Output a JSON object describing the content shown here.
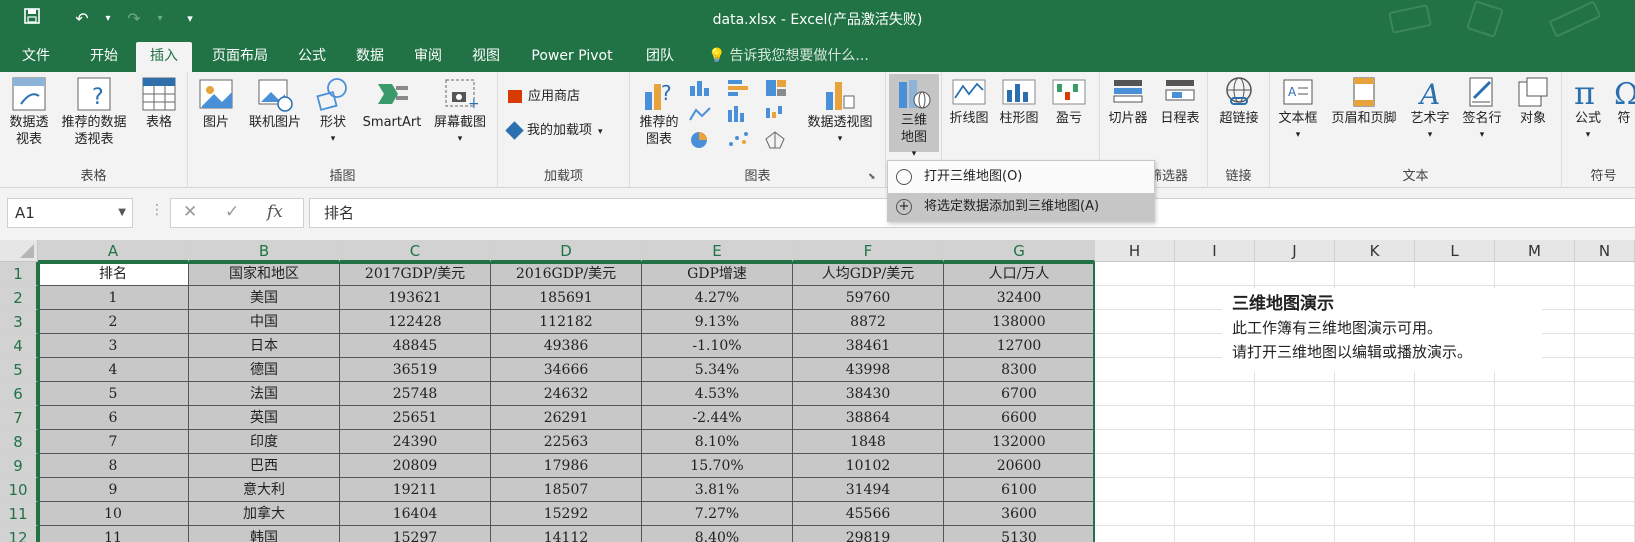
{
  "window": {
    "title": "data.xlsx - Excel(产品激活失败)"
  },
  "quick_access": {
    "save": "save-icon",
    "undo": "undo-icon",
    "redo": "redo-icon",
    "customize": "▾"
  },
  "tabs": [
    "文件",
    "开始",
    "插入",
    "页面布局",
    "公式",
    "数据",
    "审阅",
    "视图",
    "Power Pivot",
    "团队"
  ],
  "active_tab": "插入",
  "tell_me": "告诉我您想要做什么...",
  "ribbon": {
    "groups": {
      "tables": {
        "label": "表格",
        "buttons": [
          "数据透视表",
          "推荐的数据透视表",
          "表格"
        ]
      },
      "illustrations": {
        "label": "插图",
        "buttons": [
          "图片",
          "联机图片",
          "形状",
          "SmartArt",
          "屏幕截图"
        ]
      },
      "addins": {
        "label": "加载项",
        "store": "应用商店",
        "my_addins": "我的加载项"
      },
      "charts": {
        "label": "图表",
        "recommended": "推荐的图表",
        "pivot_chart": "数据透视图"
      },
      "tours": {
        "label": "三维地图"
      },
      "sparklines": {
        "buttons": [
          "折线图",
          "柱形图",
          "盈亏"
        ]
      },
      "filters": {
        "label": "筛选器",
        "buttons": [
          "切片器",
          "日程表"
        ]
      },
      "links": {
        "label": "链接",
        "buttons": [
          "超链接"
        ]
      },
      "text": {
        "label": "文本",
        "buttons": [
          "文本框",
          "页眉和页脚",
          "艺术字",
          "签名行",
          "对象"
        ]
      },
      "symbols": {
        "label": "符号",
        "buttons": [
          "公式",
          "符"
        ]
      }
    }
  },
  "map_dropdown": {
    "items": [
      "打开三维地图(O)",
      "将选定数据添加到三维地图(A)"
    ]
  },
  "formula_bar": {
    "name_box": "A1",
    "content": "排名"
  },
  "columns": [
    "A",
    "B",
    "C",
    "D",
    "E",
    "F",
    "G",
    "H",
    "I",
    "J",
    "K",
    "L",
    "M",
    "N"
  ],
  "rows": [
    "1",
    "2",
    "3",
    "4",
    "5",
    "6",
    "7",
    "8",
    "9",
    "10",
    "11",
    "12"
  ],
  "table": {
    "headers": [
      "排名",
      "国家和地区",
      "2017GDP/美元",
      "2016GDP/美元",
      "GDP增速",
      "人均GDP/美元",
      "人口/万人"
    ],
    "rows": [
      [
        "1",
        "美国",
        "193621",
        "185691",
        "4.27%",
        "59760",
        "32400"
      ],
      [
        "2",
        "中国",
        "122428",
        "112182",
        "9.13%",
        "8872",
        "138000"
      ],
      [
        "3",
        "日本",
        "48845",
        "49386",
        "-1.10%",
        "38461",
        "12700"
      ],
      [
        "4",
        "德国",
        "36519",
        "34666",
        "5.34%",
        "43998",
        "8300"
      ],
      [
        "5",
        "法国",
        "25748",
        "24632",
        "4.53%",
        "38430",
        "6700"
      ],
      [
        "6",
        "英国",
        "25651",
        "26291",
        "-2.44%",
        "38864",
        "6600"
      ],
      [
        "7",
        "印度",
        "24390",
        "22563",
        "8.10%",
        "1848",
        "132000"
      ],
      [
        "8",
        "巴西",
        "20809",
        "17986",
        "15.70%",
        "10102",
        "20600"
      ],
      [
        "9",
        "意大利",
        "19211",
        "18507",
        "3.81%",
        "31494",
        "6100"
      ],
      [
        "10",
        "加拿大",
        "16404",
        "15292",
        "7.27%",
        "45566",
        "3600"
      ],
      [
        "11",
        "韩国",
        "15297",
        "14112",
        "8.40%",
        "29819",
        "5130"
      ]
    ]
  },
  "notice": {
    "title": "三维地图演示",
    "lines": [
      "此工作簿有三维地图演示可用。",
      "请打开三维地图以编辑或播放演示。"
    ]
  },
  "colors": {
    "excel_green": "#217346",
    "ribbon_bg": "#f3f3f3",
    "selection_shade": "#c8c8c8"
  }
}
